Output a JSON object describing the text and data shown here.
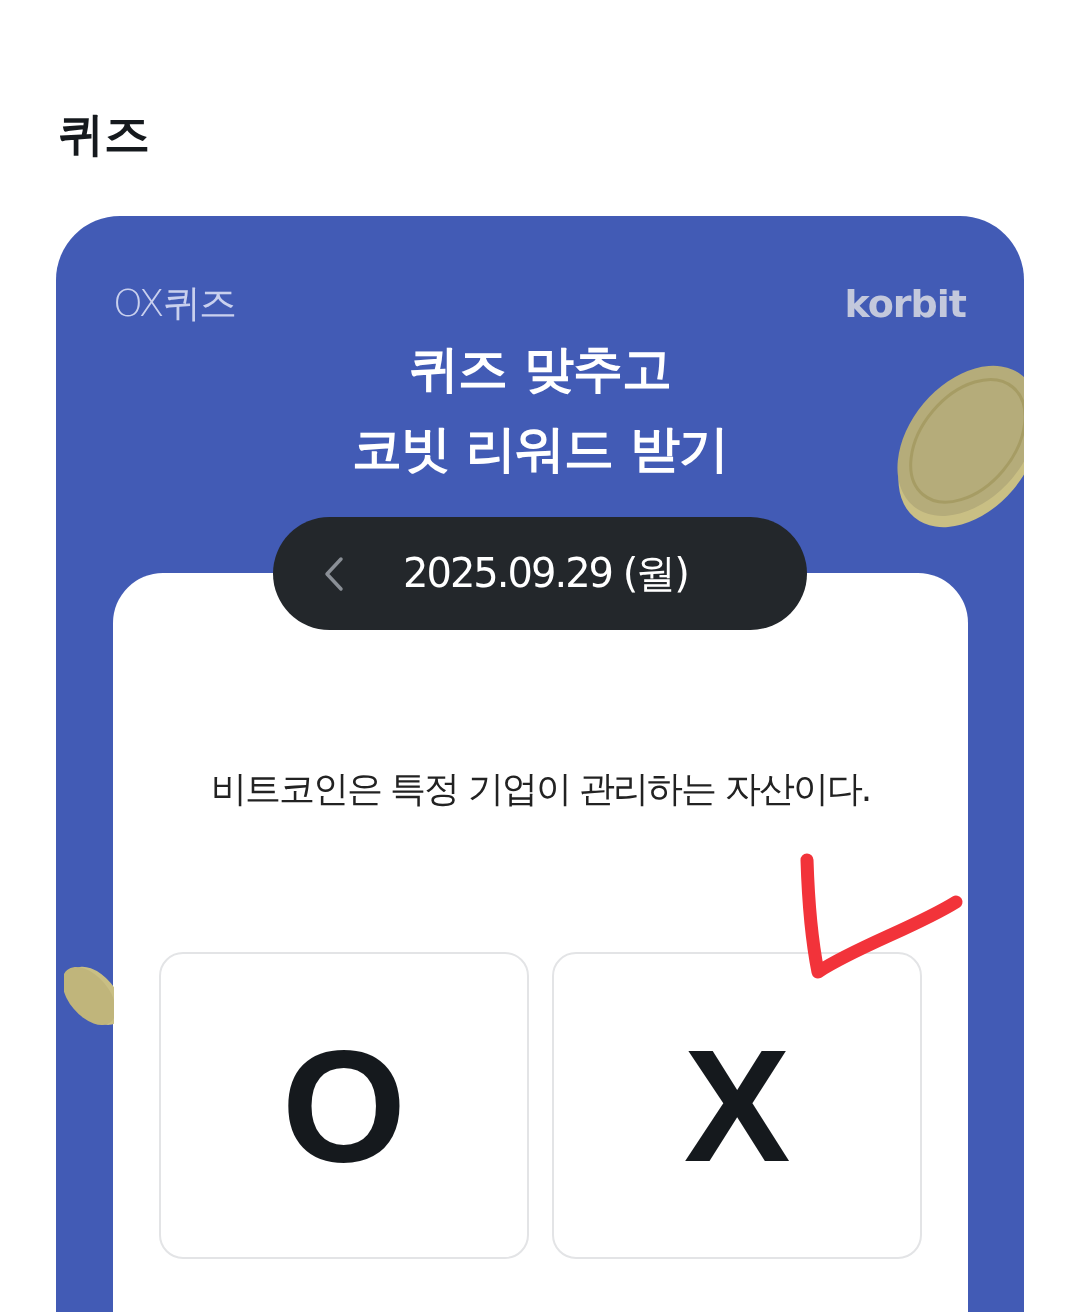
{
  "header": {
    "title": "퀴즈"
  },
  "quiz": {
    "label": "OX퀴즈",
    "brand": "korbit",
    "headline": [
      "퀴즈 맞추고",
      "코빗 리워드 받기"
    ],
    "date": "2025.09.29 (월)",
    "question": "비트코인은 특정 기업이 관리하는 자산이다.",
    "options": [
      {
        "label": "O",
        "checked": false
      },
      {
        "label": "X",
        "checked": true
      }
    ]
  }
}
